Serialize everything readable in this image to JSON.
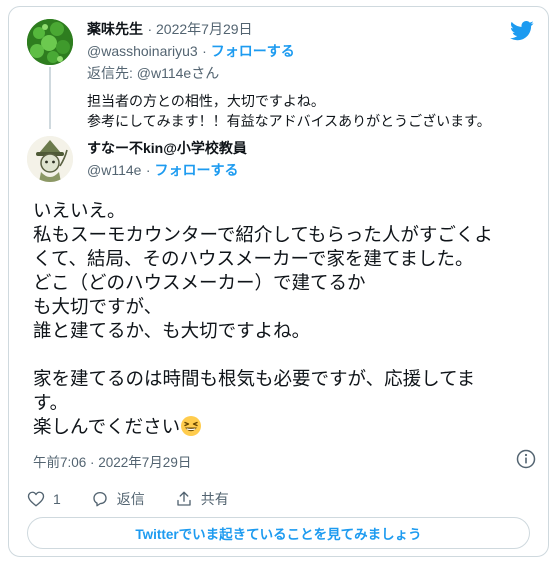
{
  "parent_tweet": {
    "author_name": "薬味先生",
    "date": "2022年7月29日",
    "handle": "@wasshoinariyu3",
    "follow_label": "フォローする",
    "reply_to_prefix": "返信先: ",
    "reply_to_handle": "@w114eさん",
    "text_lines": [
      "担当者の方との相性，大切ですよね。",
      "参考にしてみます！！有益なアドバイスありがとうございます。"
    ]
  },
  "main_tweet": {
    "author_name": "すなー不kin@小学校教員",
    "handle": "@w114e",
    "follow_label": "フォローする",
    "text_lines": [
      "いえいえ。",
      "私もスーモカウンターで紹介してもらった人がすごくよ",
      "くて、結局、そのハウスメーカーで家を建てました。",
      "どこ（どのハウスメーカー）で建てるか",
      "も大切ですが、",
      "誰と建てるか、も大切ですよね。",
      "",
      "家を建てるのは時間も根気も必要ですが、応援してま",
      "す。",
      "楽しんでください"
    ],
    "timestamp": "午前7:06 · 2022年7月29日",
    "like_count": "1",
    "reply_label": "返信",
    "share_label": "共有"
  },
  "cta_label": "Twitterでいま起きていることを見てみましょう",
  "icons": {
    "logo": "twitter-bird-icon",
    "info": "info-icon",
    "like": "heart-icon",
    "reply": "reply-bubble-icon",
    "share": "share-icon",
    "emoji": "grinning-squinting-face-icon"
  },
  "colors": {
    "accent": "#1d9bf0",
    "secondary_text": "#536471",
    "border": "#cfd9de"
  }
}
